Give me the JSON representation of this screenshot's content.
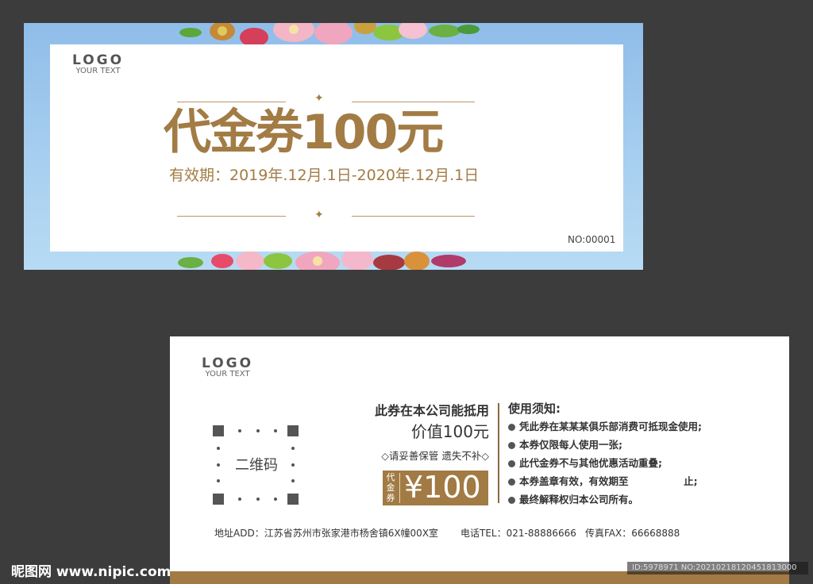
{
  "front": {
    "logo": "LOGO",
    "logo_sub": "YOUR TEXT",
    "title": "代金券100元",
    "validity": "有效期：2019年.12月.1日-2020年.12月.1日",
    "serial": "NO:00001"
  },
  "back": {
    "logo": "LOGO",
    "logo_sub": "YOUR TEXT",
    "qr_label": "二维码",
    "offer_line1": "此券在本公司能抵用",
    "offer_line2": "价值100元",
    "keep_note": "◇请妥善保管 遗失不补◇",
    "badge_small": "代金券",
    "badge_price": "¥100",
    "rules_title": "使用须知:",
    "rules": [
      "凭此券在某某某俱乐部消费可抵现金使用;",
      "本券仅限每人使用一张;",
      "此代金券不与其他优惠活动重叠;",
      "本券盖章有效，有效期至                止;",
      "最终解释权归本公司所有。"
    ],
    "address": "地址ADD：江苏省苏州市张家港市杨舍镇6X幢00X室",
    "phone": "电话TEL：021-88886666",
    "fax": "传真FAX：66668888"
  },
  "watermark": {
    "site": "昵图网 www.nipic.com",
    "id": "ID:5978971 NO:20210218120451813000"
  },
  "colors": {
    "gold": "#a27c44",
    "sky": "#8fbde9",
    "background": "#3c3c3c"
  }
}
